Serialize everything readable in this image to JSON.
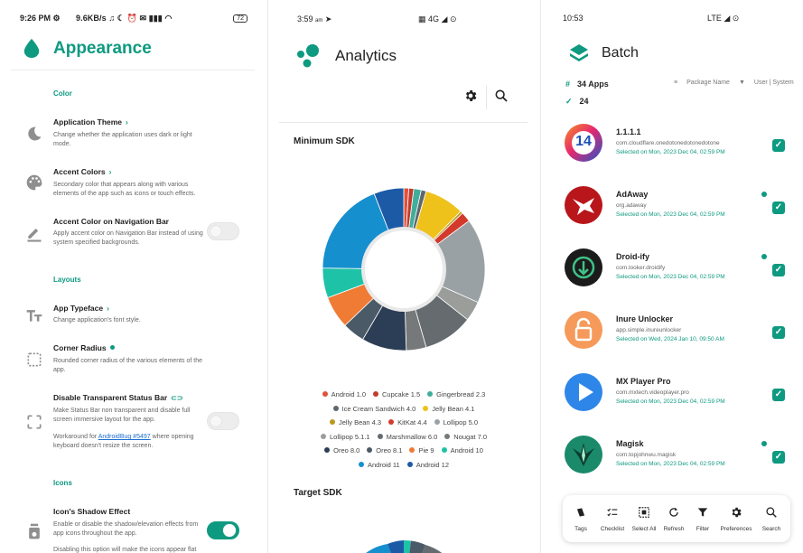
{
  "colors": {
    "accent": "#0e9a80"
  },
  "screen1": {
    "status": {
      "time": "9:26 PM",
      "net": "9.6KB/s",
      "battery": "72"
    },
    "title": "Appearance",
    "sections": {
      "color": "Color",
      "layouts": "Layouts",
      "icons": "Icons"
    },
    "prefs": {
      "theme": {
        "title": "Application Theme",
        "desc": "Change whether the application uses dark or light mode."
      },
      "accent": {
        "title": "Accent Colors",
        "desc": "Secondary color that appears along with various elements of the app such as icons or touch effects."
      },
      "navbar": {
        "title": "Accent Color on Navigation Bar",
        "desc": "Apply accent color on Navigation Bar instead of using system specified backgrounds.",
        "on": false
      },
      "typeface": {
        "title": "App Typeface",
        "desc": "Change application's font style."
      },
      "radius": {
        "title": "Corner Radius",
        "desc": "Rounded corner radius of the various elements of the app."
      },
      "transparent": {
        "title": "Disable Transparent Status Bar",
        "desc": "Make Status Bar non transparent and disable full screen immersive layout for the app.",
        "note_prefix": "Workaround for ",
        "note_link": "AndroidBug #5497",
        "note_suffix": " where opening keyboard doesn't resize the screen.",
        "on": false
      },
      "shadow": {
        "title": "Icon's Shadow Effect",
        "desc": "Enable or disable the shadow/elevation effects from app icons throughout the app.",
        "extra": "Disabling this option will make the icons appear flat",
        "on": true
      }
    }
  },
  "screen2": {
    "status": {
      "time": "3:59",
      "ampm": "am",
      "network": "4G"
    },
    "title": "Analytics",
    "min_sdk_title": "Minimum SDK",
    "target_sdk_title": "Target SDK",
    "legend": [
      {
        "label": "Android 1.0",
        "color": "#e0513b"
      },
      {
        "label": "Cupcake 1.5",
        "color": "#c23b2e"
      },
      {
        "label": "Gingerbread 2.3",
        "color": "#3fae9a"
      },
      {
        "label": "Ice Cream Sandwich 4.0",
        "color": "#5c6770"
      },
      {
        "label": "Jelly Bean 4.1",
        "color": "#efc11b"
      },
      {
        "label": "Jelly Bean 4.3",
        "color": "#b79a1c"
      },
      {
        "label": "KitKat 4.4",
        "color": "#d33a2c"
      },
      {
        "label": "Lollipop 5.0",
        "color": "#9aa1a4"
      },
      {
        "label": "Lollipop 5.1.1",
        "color": "#9b9d9b"
      },
      {
        "label": "Marshmallow 6.0",
        "color": "#656b6f"
      },
      {
        "label": "Nougat 7.0",
        "color": "#76797a"
      },
      {
        "label": "Oreo 8.0",
        "color": "#2c3e55"
      },
      {
        "label": "Oreo 8.1",
        "color": "#4a5a66"
      },
      {
        "label": "Pie 9",
        "color": "#ef7b35"
      },
      {
        "label": "Android 10",
        "color": "#1ec2a7"
      },
      {
        "label": "Android 11",
        "color": "#168fcf"
      },
      {
        "label": "Android 12",
        "color": "#1c5aa6"
      }
    ],
    "chart_data": {
      "type": "pie",
      "title": "Minimum SDK",
      "categories": [
        "Android 1.0",
        "Cupcake 1.5",
        "Gingerbread 2.3",
        "Ice Cream Sandwich 4.0",
        "Jelly Bean 4.1",
        "Jelly Bean 4.3",
        "KitKat 4.4",
        "Lollipop 5.0",
        "Lollipop 5.1.1",
        "Marshmallow 6.0",
        "Nougat 7.0",
        "Oreo 8.0",
        "Oreo 8.1",
        "Pie 9",
        "Android 10",
        "Android 11",
        "Android 12"
      ],
      "values": [
        1.0,
        1.0,
        1.5,
        1.0,
        8.0,
        0.5,
        2.0,
        17.0,
        4.0,
        10.0,
        4.0,
        9.0,
        4.5,
        6.5,
        6.0,
        19.0,
        6.0
      ],
      "legend": "bottom"
    }
  },
  "screen3": {
    "status": {
      "time": "10:53",
      "network": "LTE"
    },
    "title": "Batch",
    "apps_count": "34 Apps",
    "selected_count": "24",
    "sort": {
      "by": "Package Name",
      "filter": "User | System"
    },
    "apps": [
      {
        "name": "1.1.1.1",
        "pkg": "com.cloudflare.onedotonedotonedotone",
        "sel": "Selected on Mon, 2023 Dec 04, 02:59 PM",
        "info": false
      },
      {
        "name": "AdAway",
        "pkg": "org.adaway",
        "sel": "Selected on Mon, 2023 Dec 04, 02:59 PM",
        "info": true
      },
      {
        "name": "Droid-ify",
        "pkg": "com.looker.droidify",
        "sel": "Selected on Mon, 2023 Dec 04, 02:59 PM",
        "info": true
      },
      {
        "name": "Inure Unlocker",
        "pkg": "app.simple.inureunlocker",
        "sel": "Selected on Wed, 2024 Jan 10, 09:50 AM",
        "info": false
      },
      {
        "name": "MX Player Pro",
        "pkg": "com.mxtech.videoplayer.pro",
        "sel": "Selected on Mon, 2023 Dec 04, 02:59 PM",
        "info": false
      },
      {
        "name": "Magisk",
        "pkg": "com.topjohnwu.magisk",
        "sel": "Selected on Mon, 2023 Dec 04, 02:59 PM",
        "info": true
      }
    ],
    "icon_badge": "14",
    "bottom": [
      "Tags",
      "Checklist",
      "Select All",
      "Refresh",
      "Filter",
      "Preferences",
      "Search"
    ]
  }
}
